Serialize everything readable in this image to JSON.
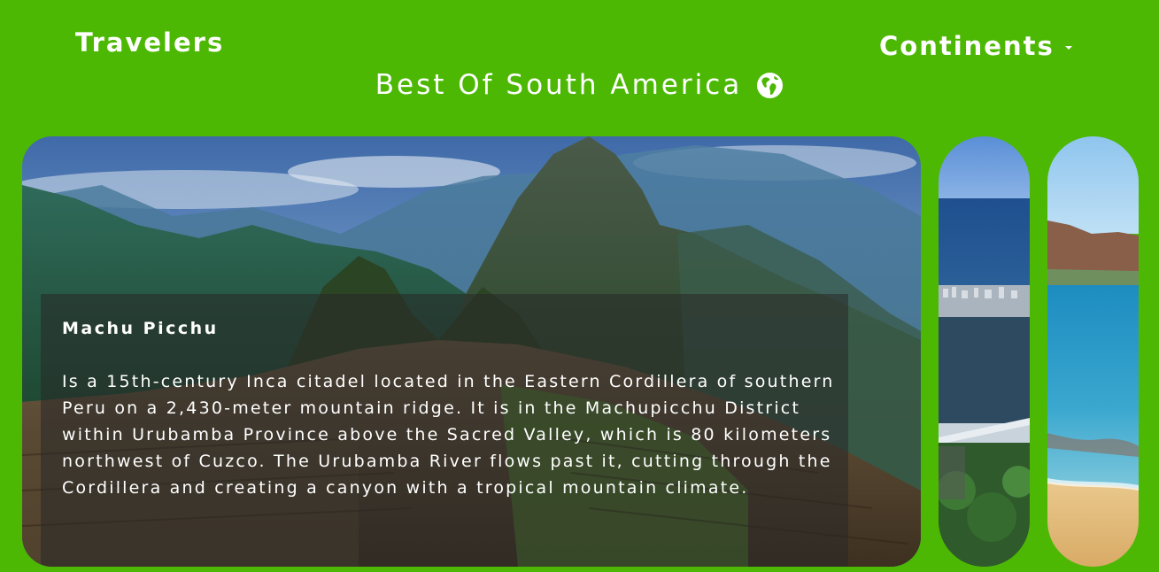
{
  "header": {
    "brand": "Travelers",
    "nav_menu_label": "Continents",
    "subtitle": "Best Of South America"
  },
  "featured": {
    "title": "Machu Picchu",
    "description": "Is a 15th-century Inca citadel located in the Eastern Cordillera of southern Peru on a 2,430-meter mountain ridge. It is in the Machupicchu District within Urubamba Province above the Sacred Valley, which is 80 kilometers northwest of Cuzco. The Urubamba River flows past it, cutting through the Cordillera and creating a canyon with a tropical mountain climate."
  },
  "colors": {
    "background": "#4cb804",
    "text": "#ffffff",
    "overlay": "rgba(40,40,40,0.55)"
  },
  "icons": {
    "subtitle_icon": "globe-americas-icon",
    "menu_icon": "caret-down-icon"
  }
}
